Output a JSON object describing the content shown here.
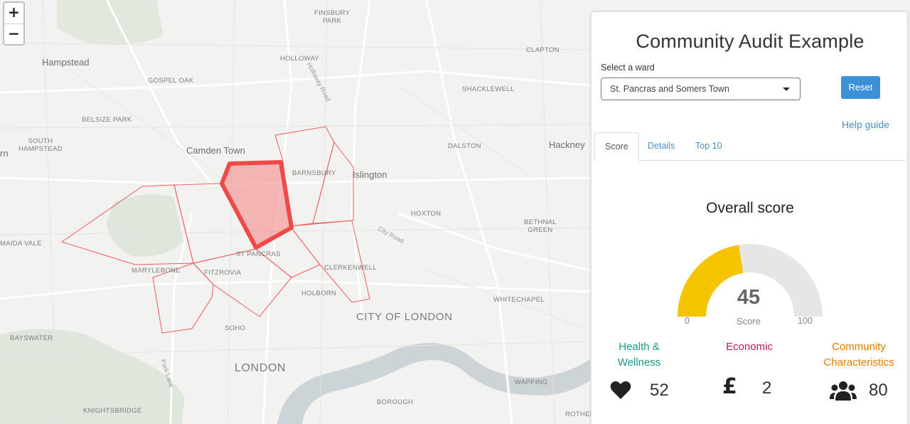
{
  "map": {
    "zoom_in": "+",
    "zoom_out": "−",
    "places": [
      {
        "id": "finsbury-park",
        "text": "FINSBURY\nPARK"
      },
      {
        "id": "hampstead",
        "text": "Hampstead"
      },
      {
        "id": "holloway",
        "text": "HOLLOWAY"
      },
      {
        "id": "clapton",
        "text": "CLAPTON"
      },
      {
        "id": "gospel-oak",
        "text": "GOSPEL OAK"
      },
      {
        "id": "shacklewell",
        "text": "SHACKLEWELL"
      },
      {
        "id": "belsize-park",
        "text": "BELSIZE PARK"
      },
      {
        "id": "south-hampstead",
        "text": "SOUTH\nHAMPSTEAD"
      },
      {
        "id": "camden-town",
        "text": "Camden Town"
      },
      {
        "id": "dalston",
        "text": "DALSTON"
      },
      {
        "id": "hackney",
        "text": "Hackney"
      },
      {
        "id": "barnsbury",
        "text": "BARNSBURY"
      },
      {
        "id": "islington",
        "text": "Islington"
      },
      {
        "id": "hoxton",
        "text": "HOXTON"
      },
      {
        "id": "bethnal-green",
        "text": "BETHNAL\nGREEN"
      },
      {
        "id": "maida-vale",
        "text": "MAIDA VALE"
      },
      {
        "id": "st-pancras",
        "text": "ST PANCRAS"
      },
      {
        "id": "marylebone",
        "text": "MARYLEBONE"
      },
      {
        "id": "fitzrovia",
        "text": "FITZROVIA"
      },
      {
        "id": "clerkenwell",
        "text": "CLERKENWELL"
      },
      {
        "id": "holborn",
        "text": "HOLBORN"
      },
      {
        "id": "whitechapel",
        "text": "WHITECHAPEL"
      },
      {
        "id": "city-of-london",
        "text": "CITY OF LONDON"
      },
      {
        "id": "bayswater",
        "text": "BAYSWATER"
      },
      {
        "id": "soho",
        "text": "SOHO"
      },
      {
        "id": "london",
        "text": "LONDON"
      },
      {
        "id": "wapping",
        "text": "WAPPING"
      },
      {
        "id": "borough",
        "text": "BOROUGH"
      },
      {
        "id": "knightsbridge",
        "text": "KNIGHTSBRIDGE"
      },
      {
        "id": "rotherhithe",
        "text": "ROTHERI"
      }
    ],
    "roads": {
      "holloway_road": "Holloway Road",
      "city_road": "City Road",
      "park_lane": "Park Lane"
    },
    "partial_label": "rn",
    "colors": {
      "ward_outline": "#f05a5a",
      "selected_fill": "#f58a8a",
      "selected_stroke": "#ee4a4a"
    }
  },
  "panel": {
    "title": "Community Audit Example",
    "ward_label": "Select a ward",
    "ward_value": "St. Pancras and Somers Town",
    "reset": "Reset",
    "help": "Help guide",
    "tabs": [
      "Score",
      "Details",
      "Top 10"
    ],
    "active_tab": "Score",
    "overall_title": "Overall score",
    "gauge": {
      "value": 45,
      "min": 0,
      "max": 100,
      "caption": "Score",
      "color": "#f5c400",
      "track_color": "#e6e6e6"
    },
    "categories": [
      {
        "label": "Health &\nWellness",
        "value": 52,
        "icon": "heart-icon",
        "color": "#1a9a86"
      },
      {
        "label": "Economic",
        "value": 2,
        "icon": "pound-sign-icon",
        "color": "#c2185b"
      },
      {
        "label": "Community\nCharacteristics",
        "value": 80,
        "icon": "users-icon",
        "color": "#e57c00"
      }
    ]
  }
}
